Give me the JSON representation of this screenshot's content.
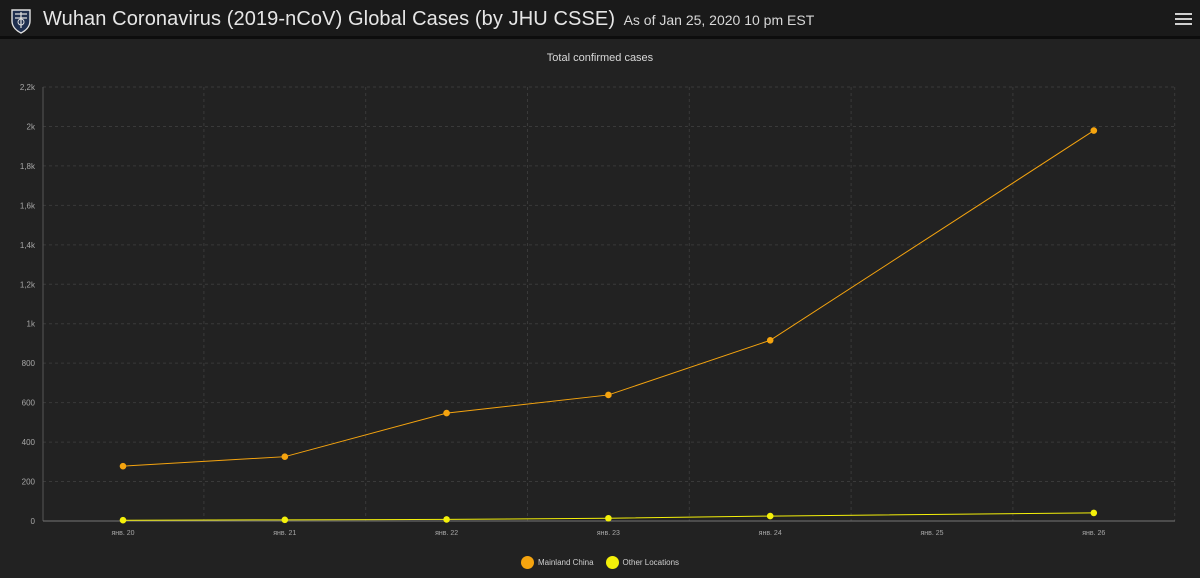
{
  "header": {
    "title": "Wuhan Coronavirus (2019-nCoV) Global Cases (by JHU CSSE)",
    "subtitle": "As of Jan 25, 2020 10 pm EST",
    "logo_icon": "university-shield-icon",
    "menu_icon": "hamburger-menu-icon"
  },
  "chart_data": {
    "type": "line",
    "title": "Total confirmed cases",
    "xlabel": "",
    "ylabel": "",
    "categories": [
      "янв. 20",
      "янв. 21",
      "янв. 22",
      "янв. 23",
      "янв. 24",
      "янв. 25",
      "янв. 26"
    ],
    "x_positions": [
      0,
      1,
      2,
      3,
      4,
      6
    ],
    "y_ticks": [
      "0",
      "200",
      "400",
      "600",
      "800",
      "1k",
      "1,2k",
      "1,4k",
      "1,6k",
      "1,8k",
      "2k",
      "2,2k"
    ],
    "ylim": [
      0,
      2200
    ],
    "grid": true,
    "legend_position": "bottom",
    "series": [
      {
        "name": "Mainland China",
        "color": "#f5a40f",
        "values": [
          278,
          326,
          547,
          639,
          916,
          1979
        ]
      },
      {
        "name": "Other Locations",
        "color": "#f4f00a",
        "values": [
          4,
          6,
          8,
          14,
          25,
          41
        ]
      }
    ]
  },
  "colors": {
    "background": "#222222",
    "header_bg": "#1a1a1a",
    "grid": "#3a3a3a",
    "axis_text": "#a8a8a8"
  }
}
